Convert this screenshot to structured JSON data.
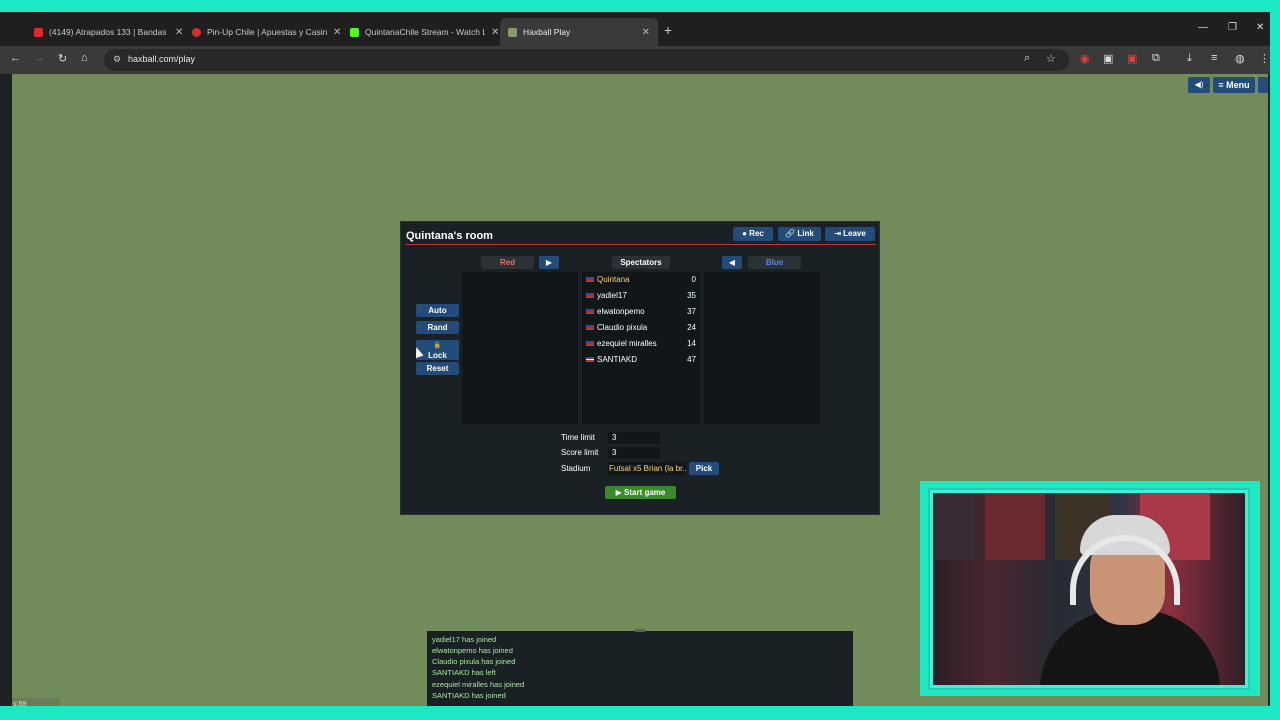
{
  "browser": {
    "tabs": [
      {
        "title": "(4149) Atrapados 133 | Bandas",
        "color": "#e0282e"
      },
      {
        "title": "Pin-Up Chile | Apuestas y Casin",
        "color": "#d2302b"
      },
      {
        "title": "QuintanaChile Stream - Watch L",
        "color": "#53fc18"
      },
      {
        "title": "Haxball Play",
        "color": "#8a9a70"
      }
    ],
    "url": "haxball.com/play"
  },
  "game": {
    "mute_icon": "speaker-icon",
    "menu_label": "≡ Menu",
    "room": {
      "title": "Quintana's room",
      "rec_label": "● Rec",
      "link_label": "🔗 Link",
      "leave_label": "⇥ Leave",
      "red_label": "Red",
      "blue_label": "Blue",
      "spectators_label": "Spectators",
      "move_right": "▶",
      "move_left": "◀",
      "auto_label": "Auto",
      "rand_label": "Rand",
      "lock_label": "Lock",
      "lock_icon": "🔓",
      "reset_label": "Reset",
      "spectators": [
        {
          "name": "Quintana",
          "points": "0"
        },
        {
          "name": "yadiel17",
          "points": "35"
        },
        {
          "name": "elwatonpemo",
          "points": "37"
        },
        {
          "name": "Claudio pixula",
          "points": "24"
        },
        {
          "name": "ezequiel miralles",
          "points": "14"
        },
        {
          "name": "SANTIAKD",
          "points": "47"
        }
      ],
      "time_limit_label": "Time limit",
      "time_limit": "3",
      "score_limit_label": "Score limit",
      "score_limit": "3",
      "stadium_label": "Stadium",
      "stadium": "Futsal x5 Brian (la br...",
      "pick_label": "Pick",
      "start_label": "▶ Start game"
    },
    "chat": [
      "yadiel17 has joined",
      "elwatonpemo has joined",
      "Claudio pixula has joined",
      "SANTIAKD has left",
      "ezequiel miralles has joined",
      "SANTIAKD has joined"
    ],
    "fps_text": "s:59"
  },
  "colors": {
    "field": "#718c5a",
    "button": "#244c7a",
    "red_team": "#e56e56",
    "blue_team": "#5689e5",
    "start": "#3b8c28",
    "frame": "#1de8c4"
  }
}
